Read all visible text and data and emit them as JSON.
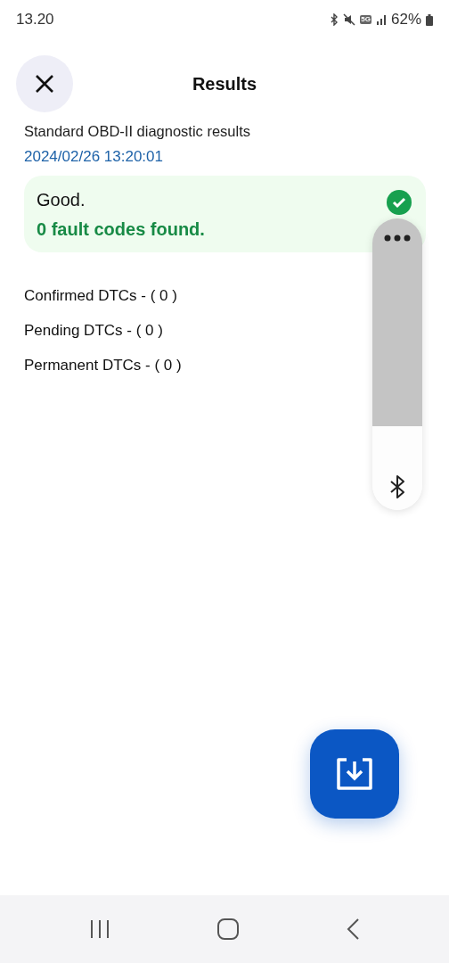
{
  "status_bar": {
    "time": "13.20",
    "network": "5G",
    "battery": "62%"
  },
  "header": {
    "title": "Results"
  },
  "subtitle": "Standard OBD-II diagnostic results",
  "timestamp": "2024/02/26 13:20:01",
  "summary": {
    "title": "Good.",
    "message": "0 fault codes found."
  },
  "dtc_groups": [
    "Confirmed DTCs - ( 0 )",
    "Pending DTCs - ( 0 )",
    "Permanent DTCs - ( 0 )"
  ]
}
